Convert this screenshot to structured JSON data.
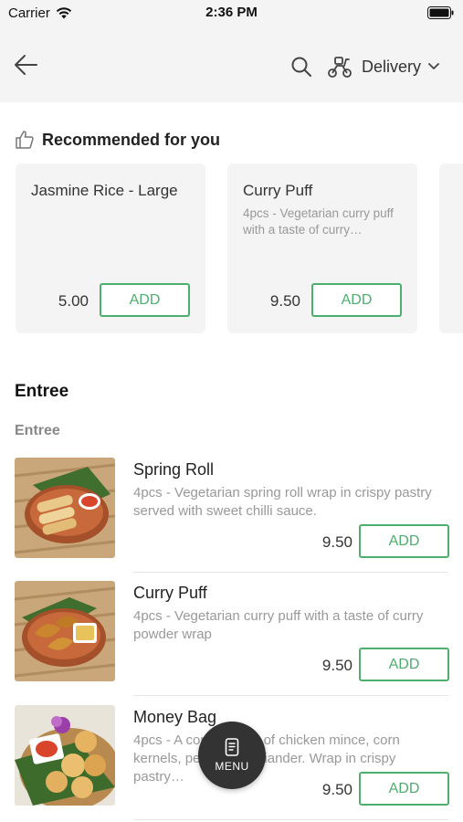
{
  "status_bar": {
    "carrier": "Carrier",
    "time": "2:36 PM"
  },
  "header": {
    "delivery_label": "Delivery"
  },
  "recommended": {
    "title": "Recommended for you",
    "items": [
      {
        "name": "Jasmine Rice - Large",
        "description": "",
        "price": "5.00",
        "add_label": "ADD"
      },
      {
        "name": "Curry Puff",
        "description": "4pcs - Vegetarian curry puff with a taste of curry…",
        "price": "9.50",
        "add_label": "ADD"
      }
    ]
  },
  "section": {
    "title": "Entree",
    "subtitle": "Entree"
  },
  "items": [
    {
      "name": "Spring Roll",
      "description": "4pcs - Vegetarian spring roll wrap in crispy pastry served with sweet chilli sauce.",
      "price": "9.50",
      "add_label": "ADD"
    },
    {
      "name": "Curry Puff",
      "description": "4pcs - Vegetarian curry puff with a taste of curry powder wrap",
      "price": "9.50",
      "add_label": "ADD"
    },
    {
      "name": "Money Bag",
      "description": "4pcs - A combination of chicken mince, corn kernels, peas and coriander. Wrap in crispy pastry…",
      "price": "9.50",
      "add_label": "ADD"
    }
  ],
  "menu_fab": {
    "label": "MENU"
  },
  "colors": {
    "accent": "#4caf6d",
    "header_bg": "#f4f4f4",
    "fab_bg": "#333333"
  }
}
